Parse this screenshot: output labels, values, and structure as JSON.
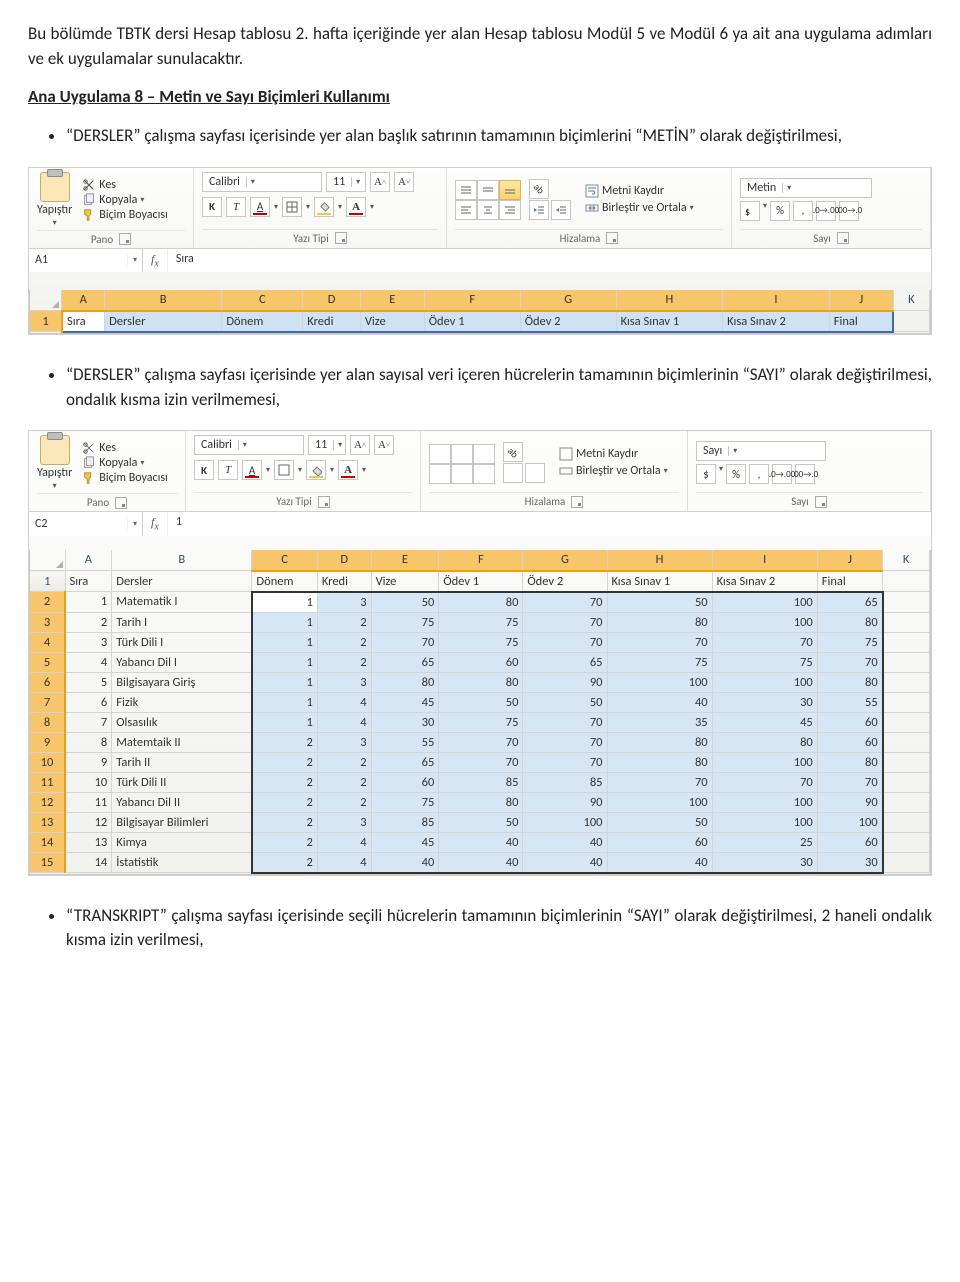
{
  "para1": "Bu bölümde TBTK dersi Hesap tablosu 2. hafta içeriğinde yer alan Hesap tablosu Modül 5 ve Modül 6 ya ait ana uygulama adımları ve ek uygulamalar sunulacaktır.",
  "heading": "Ana Uygulama 8 – Metin ve Sayı Biçimleri Kullanımı",
  "bullet1": "“DERSLER” çalışma sayfası içerisinde yer alan başlık satırının tamamının biçimlerini “METİN” olarak değiştirilmesi,",
  "bullet2": "“DERSLER” çalışma sayfası içerisinde yer alan sayısal veri içeren hücrelerin tamamının biçimlerinin “SAYI” olarak değiştirilmesi, ondalık kısma izin verilmemesi,",
  "bullet3": "“TRANSKRIPT” çalışma sayfası içerisinde seçili hücrelerin tamamının biçimlerinin “SAYI” olarak değiştirilmesi, 2 haneli ondalık kısma izin verilmesi,",
  "ribbon": {
    "paste": "Yapıştır",
    "cut": "Kes",
    "copy": "Kopyala",
    "formatPainter": "Biçim Boyacısı",
    "grpPano": "Pano",
    "font": "Calibri",
    "size": "11",
    "grpFont": "Yazı Tipi",
    "bold": "K",
    "italic": "T",
    "underline": "A",
    "grpAlign": "Hizalama",
    "wrap": "Metni Kaydır",
    "merge": "Birleştir ve Ortala",
    "grpNum": "Sayı",
    "fmt1": "Metin",
    "fmt2": "Sayı",
    "pct": "%",
    "comma": ",",
    "decInc": "⁺⁰₀₀",
    "decDec": "⁰⁰₋₀"
  },
  "fig1": {
    "nameBox": "A1",
    "fxVal": "Sıra",
    "cols": [
      "A",
      "B",
      "C",
      "D",
      "E",
      "F",
      "G",
      "H",
      "I",
      "J",
      "K"
    ],
    "row1": [
      "Sıra",
      "Dersler",
      "Dönem",
      "Kredi",
      "Vize",
      "Ödev 1",
      "Ödev 2",
      "Kısa Sınav 1",
      "Kısa Sınav 2",
      "Final",
      ""
    ]
  },
  "fig2": {
    "nameBox": "C2",
    "fxVal": "1",
    "cols": [
      "A",
      "B",
      "C",
      "D",
      "E",
      "F",
      "G",
      "H",
      "I",
      "J",
      "K"
    ],
    "header": [
      "Sıra",
      "Dersler",
      "Dönem",
      "Kredi",
      "Vize",
      "Ödev 1",
      "Ödev 2",
      "Kısa Sınav 1",
      "Kısa Sınav 2",
      "Final"
    ],
    "rows": [
      {
        "n": 1,
        "d": "Matematik I",
        "v": [
          1,
          3,
          50,
          80,
          70,
          50,
          100,
          65
        ]
      },
      {
        "n": 2,
        "d": "Tarih I",
        "v": [
          1,
          2,
          75,
          75,
          70,
          80,
          100,
          80
        ]
      },
      {
        "n": 3,
        "d": "Türk Dili I",
        "v": [
          1,
          2,
          70,
          75,
          70,
          70,
          70,
          75
        ]
      },
      {
        "n": 4,
        "d": "Yabancı Dil I",
        "v": [
          1,
          2,
          65,
          60,
          65,
          75,
          75,
          70
        ]
      },
      {
        "n": 5,
        "d": "Bilgisayara Giriş",
        "v": [
          1,
          3,
          80,
          80,
          90,
          100,
          100,
          80
        ]
      },
      {
        "n": 6,
        "d": "Fizik",
        "v": [
          1,
          4,
          45,
          50,
          50,
          40,
          30,
          55
        ]
      },
      {
        "n": 7,
        "d": "Olsasılık",
        "v": [
          1,
          4,
          30,
          75,
          70,
          35,
          45,
          60
        ]
      },
      {
        "n": 8,
        "d": "Matemtaik II",
        "v": [
          2,
          3,
          55,
          70,
          70,
          80,
          80,
          60
        ]
      },
      {
        "n": 9,
        "d": "Tarih II",
        "v": [
          2,
          2,
          65,
          70,
          70,
          80,
          100,
          80
        ]
      },
      {
        "n": 10,
        "d": "Türk Dili II",
        "v": [
          2,
          2,
          60,
          85,
          85,
          70,
          70,
          70
        ]
      },
      {
        "n": 11,
        "d": "Yabancı Dil II",
        "v": [
          2,
          2,
          75,
          80,
          90,
          100,
          100,
          90
        ]
      },
      {
        "n": 12,
        "d": "Bilgisayar Bilimleri",
        "v": [
          2,
          3,
          85,
          50,
          100,
          50,
          100,
          100
        ]
      },
      {
        "n": 13,
        "d": "Kimya",
        "v": [
          2,
          4,
          45,
          40,
          40,
          60,
          25,
          60
        ]
      },
      {
        "n": 14,
        "d": "İstatistik",
        "v": [
          2,
          4,
          40,
          40,
          40,
          40,
          30,
          30
        ]
      }
    ]
  }
}
